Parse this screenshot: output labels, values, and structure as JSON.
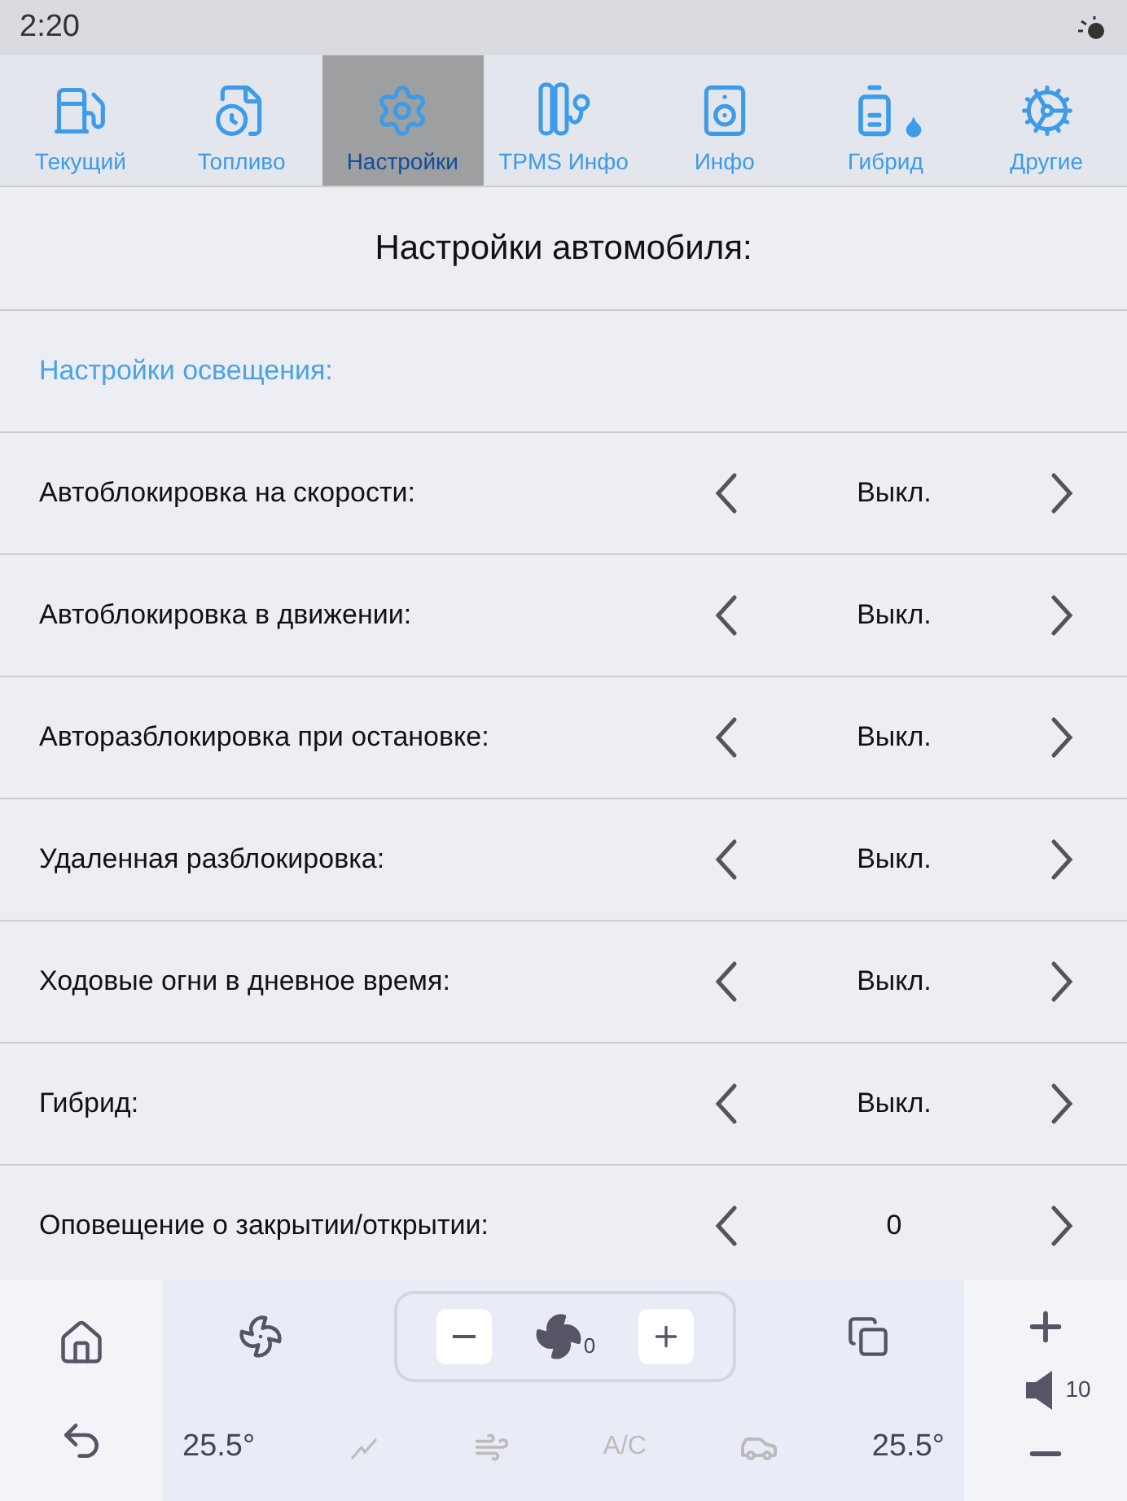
{
  "status_bar": {
    "time": "2:20"
  },
  "tabs": [
    {
      "label": "Текущий",
      "selected": false
    },
    {
      "label": "Топливо",
      "selected": false
    },
    {
      "label": "Настройки",
      "selected": true
    },
    {
      "label": "TPMS Инфо",
      "selected": false
    },
    {
      "label": "Инфо",
      "selected": false
    },
    {
      "label": "Гибрид",
      "selected": false
    },
    {
      "label": "Другие",
      "selected": false
    }
  ],
  "page_title": "Настройки автомобиля:",
  "settings": [
    {
      "kind": "section",
      "label": "Настройки освещения:"
    },
    {
      "kind": "option",
      "label": "Автоблокировка на скорости:",
      "value": "Выкл."
    },
    {
      "kind": "option",
      "label": "Автоблокировка в движении:",
      "value": "Выкл."
    },
    {
      "kind": "option",
      "label": "Авторазблокировка при остановке:",
      "value": "Выкл."
    },
    {
      "kind": "option",
      "label": "Удаленная разблокировка:",
      "value": "Выкл."
    },
    {
      "kind": "option",
      "label": "Ходовые огни в дневное время:",
      "value": "Выкл."
    },
    {
      "kind": "option",
      "label": "Гибрид:",
      "value": "Выкл."
    },
    {
      "kind": "option",
      "label": "Оповещение о закрытии/открытии:",
      "value": "0"
    }
  ],
  "climate": {
    "fan_speed": "0",
    "left_temp": "25.5°",
    "ac_label": "A/C",
    "right_temp": "25.5°",
    "volume": "10"
  }
}
